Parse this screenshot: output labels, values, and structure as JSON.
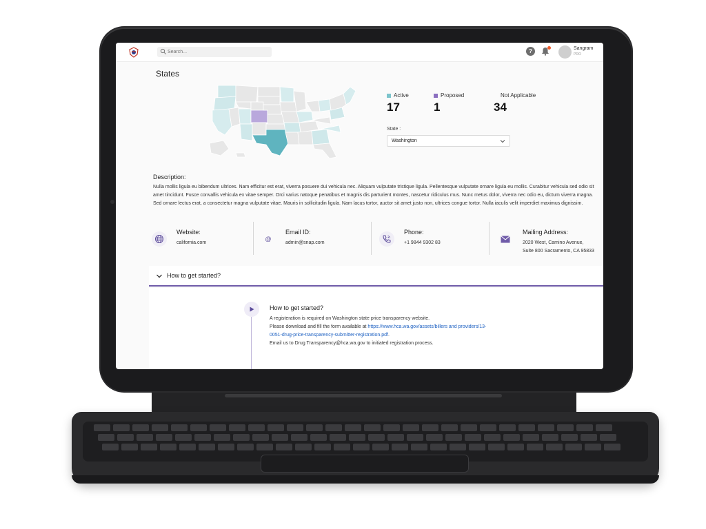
{
  "header": {
    "search_placeholder": "Search...",
    "help_label": "?",
    "user_name": "Sangram",
    "user_role": "PRO"
  },
  "page": {
    "title": "States"
  },
  "map": {
    "colors": {
      "active": "#7cc4cc",
      "proposed": "#9d8fcf",
      "not_applicable": "#e7e7e7",
      "light_active": "#cfe8ea"
    },
    "highlighted_state": "Texas",
    "proposed_state": "Colorado"
  },
  "stats": [
    {
      "label": "Active",
      "value": "17",
      "color": "#7cc4cc"
    },
    {
      "label": "Proposed",
      "value": "1",
      "color": "#8b6fc0"
    },
    {
      "label": "Not Applicable",
      "value": "34",
      "color": ""
    }
  ],
  "state_select": {
    "label": "State :",
    "value": "Washington"
  },
  "description": {
    "title": "Description:",
    "text": "Nulla mollis ligula eu bibendum ultrices. Nam efficitur est erat, viverra posuere dui vehicula nec. Aliquam vulputate tristique ligula. Pellentesque vulputate ornare ligula eu mollis. Curabitur vehicula sed odio sit amet tincidunt. Fusce convallis vehicula ex vitae semper. Orci varius natoque penatibus et magnis dis parturient montes, nascetur ridiculus mus. Nunc metus dolor, viverra nec odio eu, dictum viverra magna. Sed ornare lectus erat, a consectetur magna vulputate vitae. Mauris in sollicitudin ligula. Nam lacus tortor, auctor sit amet justo non, ultrices congue tortor. Nulla iaculis velit imperdiet maximus dignissim."
  },
  "contacts": {
    "website": {
      "title": "Website:",
      "value": "california.com"
    },
    "email": {
      "title": "Email ID:",
      "value": "admin@snap.com"
    },
    "phone": {
      "title": "Phone:",
      "value": "+1 9844 9302 83"
    },
    "address": {
      "title": "Mailing Address:",
      "line1": "2020 West, Camino Avenue,",
      "line2": "Suite 800 Sacramento, CA 95833"
    }
  },
  "accordion": {
    "title": "How to get started?"
  },
  "step": {
    "title": "How to get started?",
    "line1": "A registeration is required on Washington state price transparency website.",
    "line2_prefix": "Please download and fill the form available at ",
    "link": "https://www.hca.wa.gov/assets/billers and providers/13-0051-drug-price-transparency-submitter-registration.pdf",
    "line2_suffix": ".",
    "line3": "Email us to Drug Transparency@hca.wa.gov to initiated registration process."
  },
  "theme": {
    "accent": "#6f5ba8"
  }
}
